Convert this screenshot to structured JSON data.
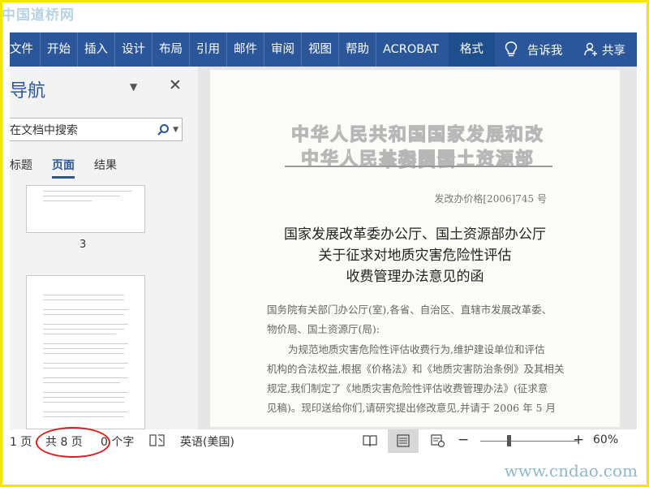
{
  "watermark": {
    "top": "中国道桥网",
    "bottom": "www.cndao.com"
  },
  "ribbon": {
    "tabs": [
      "文件",
      "开始",
      "插入",
      "设计",
      "布局",
      "引用",
      "邮件",
      "审阅",
      "视图",
      "帮助",
      "ACROBAT"
    ],
    "active_tab": "格式",
    "tell_me": "告诉我",
    "share": "共享",
    "bg_color": "#2b579a"
  },
  "nav": {
    "title": "导航",
    "search_placeholder": "在文档中搜索",
    "tabs": [
      "标题",
      "页面",
      "结果"
    ],
    "active_tab": "页面",
    "page_label": "3"
  },
  "document": {
    "org_line1": "中华人民共和国国家发展和改革委员会",
    "org_line2": "中华人民共和国国土资源部",
    "doc_number": "发改办价格[2006]745 号",
    "title_line1": "国家发展改革委办公厅、国土资源部办公厅",
    "title_line2": "关于征求对地质灾害危险性评估",
    "title_line3": "收费管理办法意见的函",
    "body_lines": [
      "国务院有关部门办公厅(室),各省、自治区、直辖市发展改革委、",
      "物价局、国土资源厅(局):",
      "为规范地质灾害危险性评估收费行为,维护建设单位和评估",
      "机构的合法权益,根据《价格法》和《地质灾害防治条例》及其相关",
      "规定,我们制定了《地质灾害危险性评估收费管理办法》(征求意",
      "见稿)。现印送给你们,请研究提出修改意见,并请于 2006 年 5 月"
    ]
  },
  "status": {
    "page_info": "1 页",
    "total_pages": "共 8 页",
    "word_count": "0 个字",
    "language": "英语(美国)",
    "zoom": "60%",
    "zoom_level": 0.35,
    "highlight_color": "#e01a1a"
  }
}
